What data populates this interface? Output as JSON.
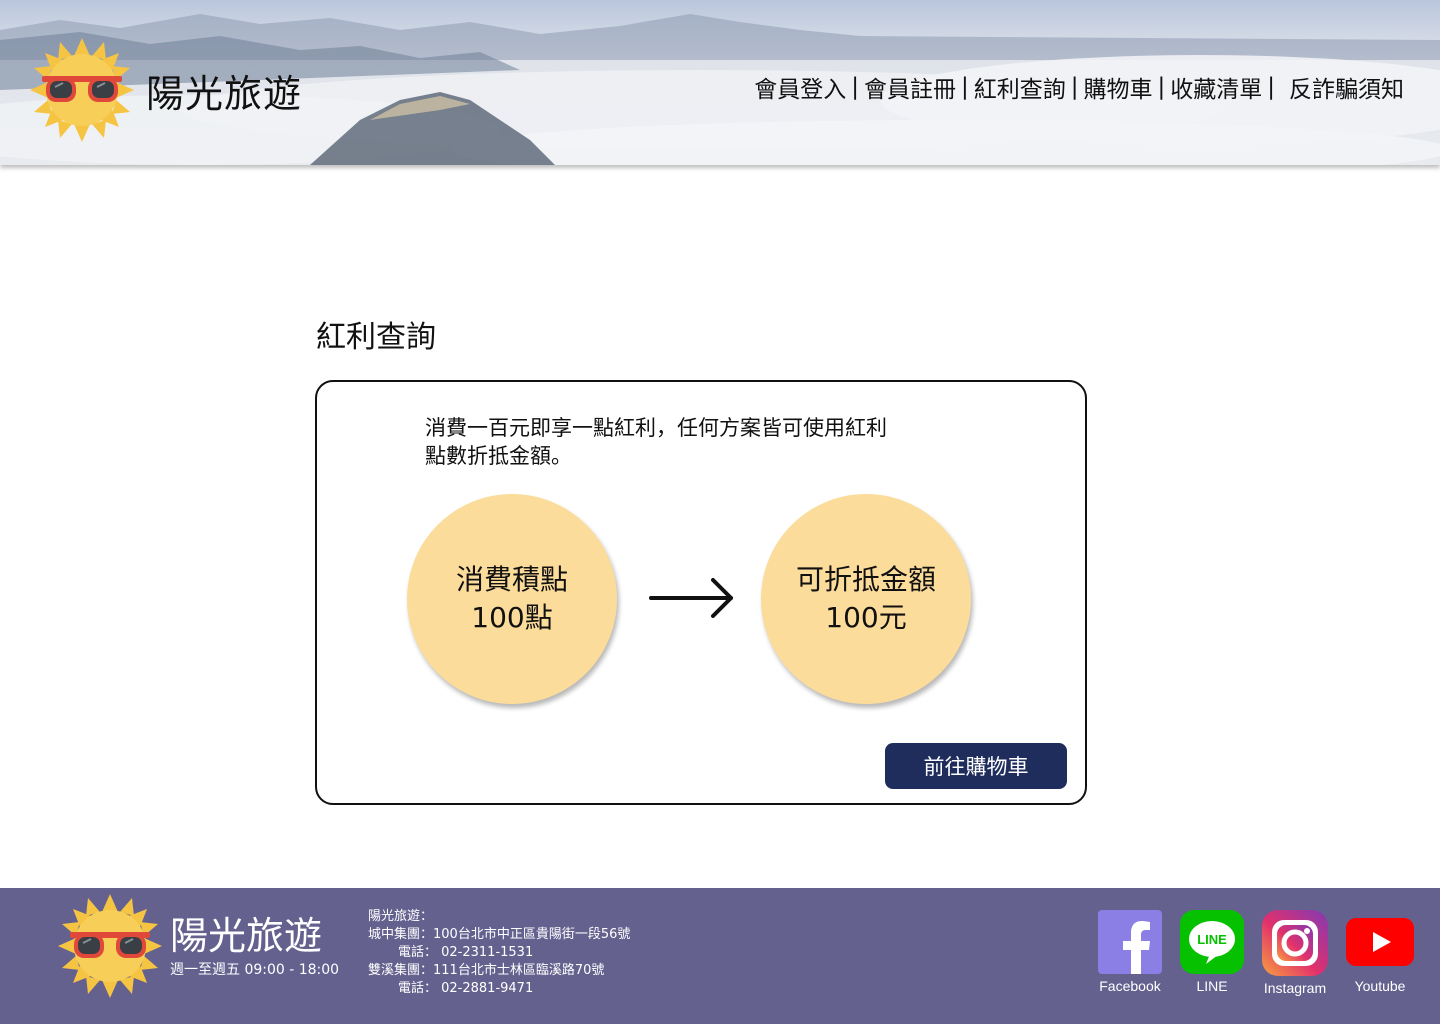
{
  "header": {
    "brand_name": "陽光旅遊",
    "nav": [
      {
        "label": "會員登入"
      },
      {
        "label": "會員註冊"
      },
      {
        "label": "紅利查詢"
      },
      {
        "label": "購物車"
      },
      {
        "label": "收藏清單"
      },
      {
        "label": "反詐騙須知"
      }
    ],
    "nav_separator": "|"
  },
  "main": {
    "title": "紅利查詢",
    "description_line1": "消費一百元即享一點紅利，任何方案皆可使用紅利",
    "description_line2": "點數折抵金額。",
    "points_circle": {
      "line1": "消費積點",
      "line2": "100點"
    },
    "amount_circle": {
      "line1": "可折抵金額",
      "line2": "100元"
    },
    "cart_button": "前往購物車"
  },
  "footer": {
    "brand_name": "陽光旅遊",
    "hours": "週一至週五 09:00 - 18:00",
    "contact": {
      "company": "陽光旅遊：",
      "branch1": "城中集團：100台北市中正區貴陽街一段56號",
      "phone1": "電話： 02-2311-1531",
      "branch2": "雙溪集團：111台北市士林區臨溪路70號",
      "phone2": "電話： 02-2881-9471"
    },
    "social": [
      {
        "label": "Facebook",
        "icon": "facebook-icon"
      },
      {
        "label": "LINE",
        "icon": "line-icon"
      },
      {
        "label": "Instagram",
        "icon": "instagram-icon"
      },
      {
        "label": "Youtube",
        "icon": "youtube-icon"
      }
    ]
  },
  "colors": {
    "button_navy": "#1f2d5c",
    "circle_peach": "#fcdc9b",
    "footer_purple": "#65618f",
    "sun_yellow": "#f5c443",
    "sunglasses_red": "#e0493a"
  }
}
